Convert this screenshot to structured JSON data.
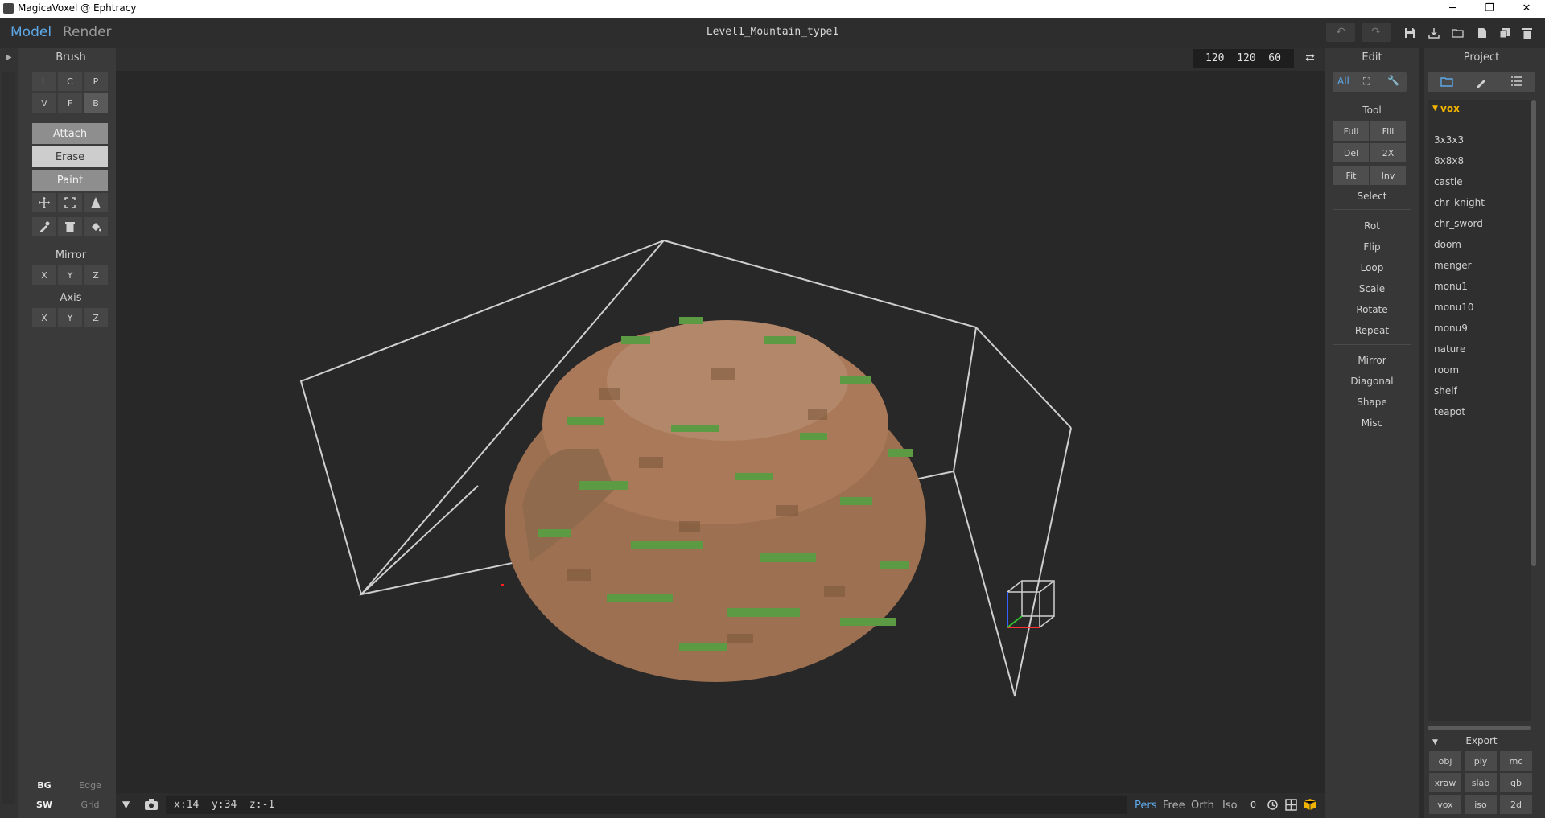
{
  "window": {
    "title": "MagicaVoxel @ Ephtracy",
    "minimize": "─",
    "maximize": "❐",
    "close": "✕"
  },
  "topbar": {
    "mode_model": "Model",
    "mode_render": "Render",
    "doc_title": "Level1_Mountain_type1",
    "undo": "↶",
    "redo": "↷"
  },
  "brush": {
    "title": "Brush",
    "types": [
      "L",
      "C",
      "P",
      "V",
      "F",
      "B"
    ],
    "actions": [
      "Attach",
      "Erase",
      "Paint"
    ],
    "mirror_title": "Mirror",
    "mirror": [
      "X",
      "Y",
      "Z"
    ],
    "axis_title": "Axis",
    "axis": [
      "X",
      "Y",
      "Z"
    ]
  },
  "left_bottom": {
    "bg": "BG",
    "edge": "Edge",
    "sw": "SW",
    "grid": "Grid"
  },
  "viewport": {
    "dims": "120  120  60"
  },
  "edit": {
    "title": "Edit",
    "filter_all": "All",
    "tool_title": "Tool",
    "tools": [
      "Full",
      "Fill",
      "Del",
      "2X",
      "Fit",
      "Inv"
    ],
    "select": "Select",
    "ops": [
      "Rot",
      "Flip",
      "Loop",
      "Scale",
      "Rotate",
      "Repeat"
    ],
    "ops2": [
      "Mirror",
      "Diagonal",
      "Shape",
      "Misc"
    ]
  },
  "project": {
    "title": "Project",
    "folder": "vox",
    "items": [
      "3x3x3",
      "8x8x8",
      "castle",
      "chr_knight",
      "chr_sword",
      "doom",
      "menger",
      "monu1",
      "monu10",
      "monu9",
      "nature",
      "room",
      "shelf",
      "teapot"
    ],
    "export_title": "Export",
    "export": [
      "obj",
      "ply",
      "mc",
      "xraw",
      "slab",
      "qb",
      "vox",
      "iso",
      "2d"
    ]
  },
  "status": {
    "coords": "x:14  y:34  z:-1",
    "pers": "Pers",
    "free": "Free",
    "orth": "Orth",
    "iso": "Iso",
    "zero": "0"
  },
  "colors": {
    "accent": "#5fa8e8",
    "folder": "#f0b400",
    "dirt": "#a77a59",
    "grass": "#5c9a44"
  }
}
